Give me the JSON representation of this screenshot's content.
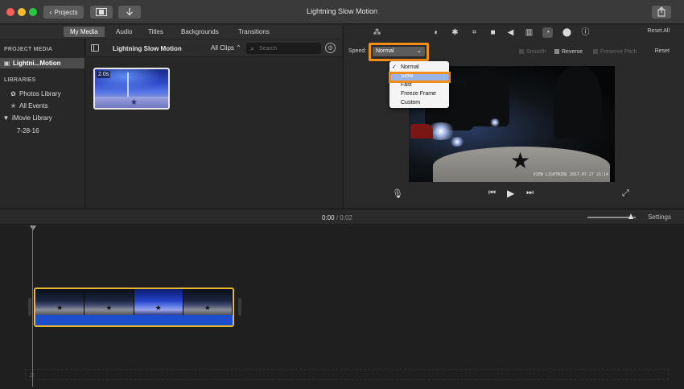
{
  "window": {
    "title": "Lightning Slow Motion",
    "projects_button": "Projects",
    "projects_chevron": "‹"
  },
  "media_tabs": [
    "My Media",
    "Audio",
    "Titles",
    "Backgrounds",
    "Transitions"
  ],
  "sidebar": {
    "project_media_header": "PROJECT MEDIA",
    "project_item": "Lightni...Motion",
    "libraries_header": "LIBRARIES",
    "items": [
      {
        "label": "Photos Library",
        "icon": "photos-icon"
      },
      {
        "label": "All Events",
        "icon": "star-icon"
      },
      {
        "label": "iMovie Library",
        "icon": "disclosure-icon"
      },
      {
        "label": "7-28-16",
        "icon": ""
      }
    ]
  },
  "browser": {
    "title": "Lightning Slow Motion",
    "filter": "All Clips",
    "filter_caret": "⌃",
    "search_placeholder": "Search",
    "clip_duration": "2.0s"
  },
  "inspector": {
    "reset_all": "Reset All",
    "speed_label": "Speed:",
    "speed_value": "Normal",
    "options": [
      {
        "label": "Smooth",
        "checked": false
      },
      {
        "label": "Reverse",
        "checked": true
      },
      {
        "label": "Preserve Pitch",
        "checked": false
      }
    ],
    "reset": "Reset",
    "speed_menu": [
      {
        "label": "Normal",
        "checked": true
      },
      {
        "label": "Slow",
        "checked": false,
        "highlighted": true
      },
      {
        "label": "Fast",
        "checked": false
      },
      {
        "label": "Freeze Frame",
        "checked": false
      },
      {
        "label": "Custom",
        "checked": false
      }
    ],
    "check_mark": "✓"
  },
  "viewer": {
    "timestamp_overlay": "VIEW LIGHTNING 2017-07-27 21:14"
  },
  "timeline": {
    "current_time": "0:00",
    "separator": "/",
    "total_time": "0:02",
    "settings": "Settings"
  },
  "colors": {
    "highlight_orange": "#f28c1a",
    "selected_clip_border": "#e7b931",
    "audio_blue": "#1d4dcc"
  }
}
